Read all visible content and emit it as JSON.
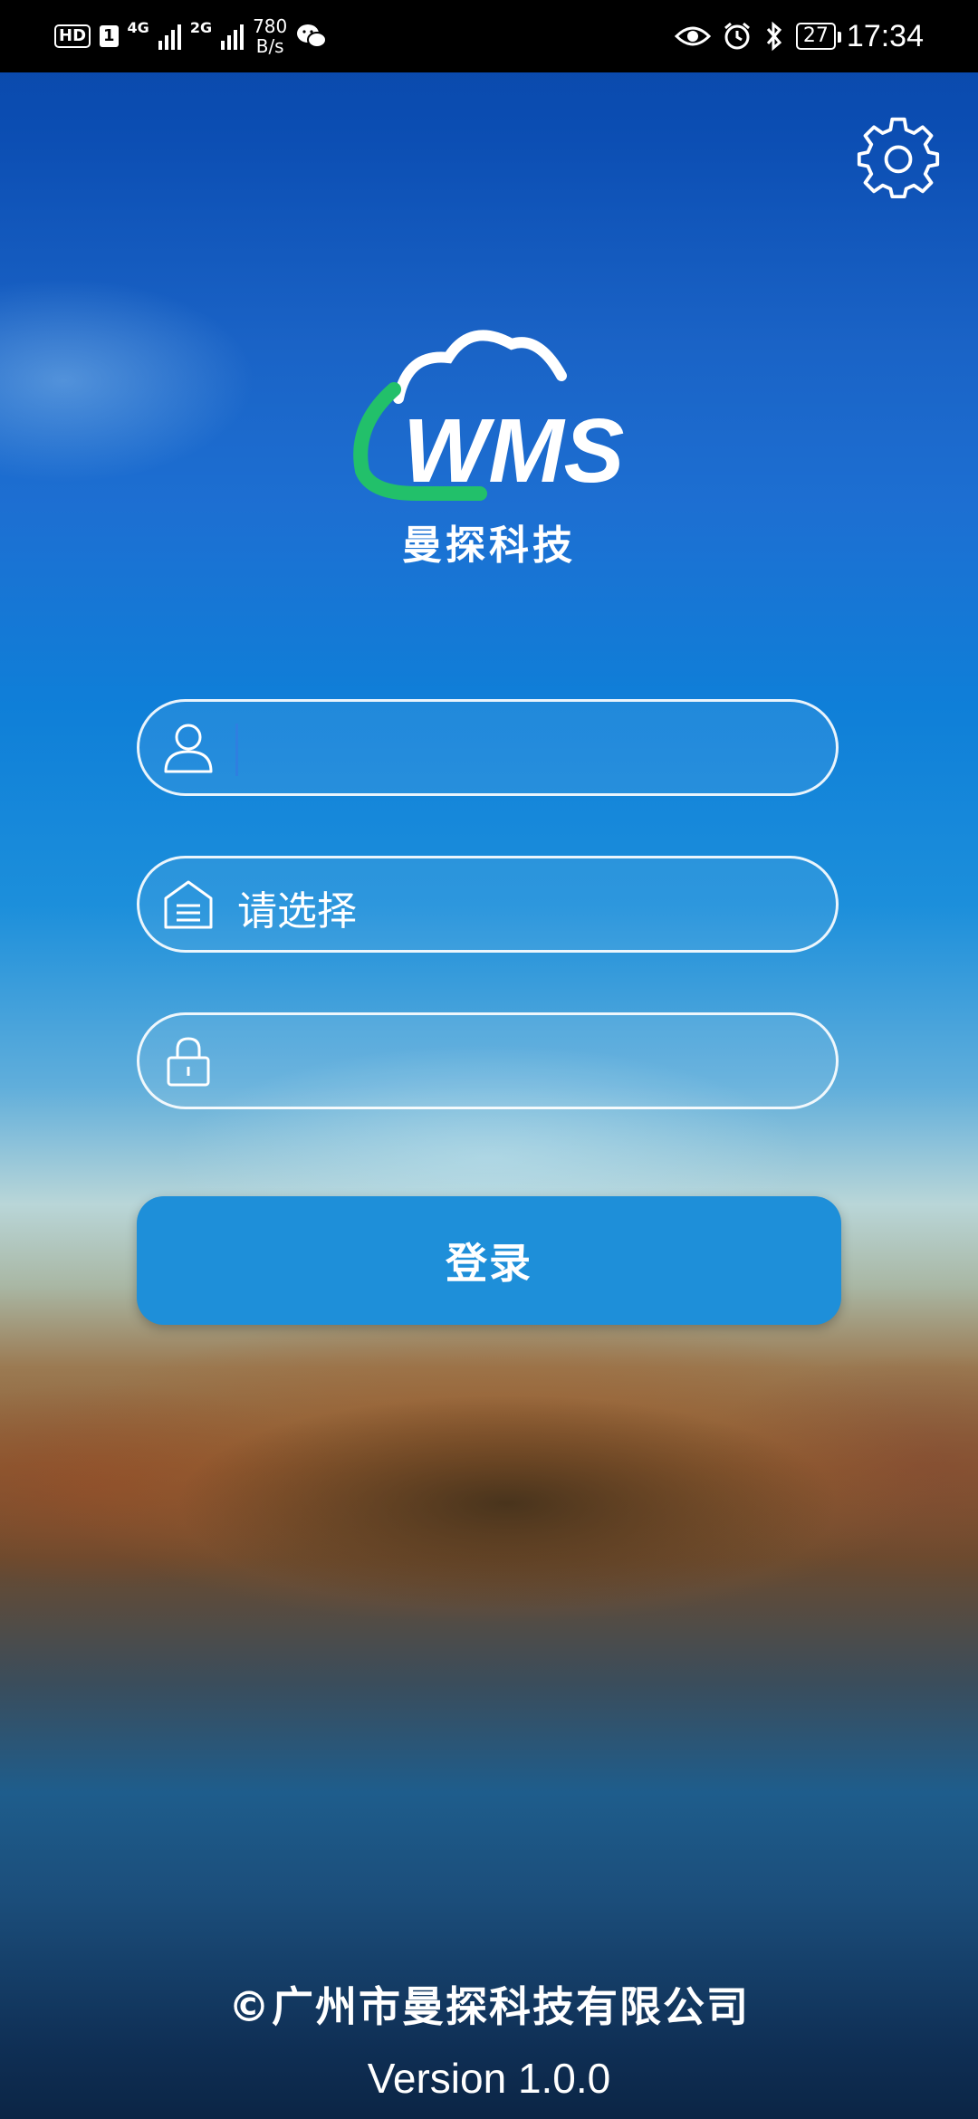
{
  "status_bar": {
    "hd_label": "HD",
    "sim1_label": "1",
    "net1_label": "4G",
    "net2_label": "2G",
    "speed_value": "780",
    "speed_unit": "B/s",
    "battery_level": "27",
    "time": "17:34",
    "icons": [
      "wechat-icon",
      "eye-icon",
      "alarm-icon",
      "bluetooth-icon",
      "battery-icon"
    ]
  },
  "header": {
    "settings_icon": "gear-icon"
  },
  "logo": {
    "wordmark": "WMS",
    "brand_name": "曼探科技",
    "colors": {
      "cloud": "#ffffff",
      "swoosh": "#22c06a"
    }
  },
  "form": {
    "username": {
      "value": "",
      "icon": "user-icon"
    },
    "warehouse": {
      "placeholder": "请选择",
      "icon": "warehouse-icon"
    },
    "password": {
      "value": "",
      "icon": "lock-icon"
    },
    "login_label": "登录"
  },
  "footer": {
    "copyright": "©广州市曼探科技有限公司",
    "version": "Version 1.0.0"
  },
  "colors": {
    "login_button": "#1e8fd9",
    "caret": "#2f7fe0"
  }
}
